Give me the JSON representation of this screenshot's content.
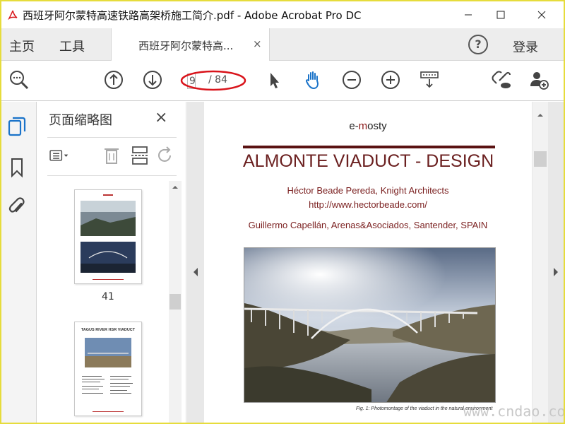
{
  "window": {
    "title": "西班牙阿尔蒙特高速铁路高架桥施工简介.pdf - Adobe Acrobat Pro DC",
    "logo_overlay": "西班牙"
  },
  "tabbar": {
    "home": "主页",
    "tools": "工具",
    "doc_tab": "西班牙阿尔蒙特高...",
    "close_tab": "×",
    "help": "?",
    "login": "登录"
  },
  "toolbar": {
    "current_page": "9",
    "total_pages": "/ 84",
    "icons": [
      "zoom-icon",
      "page-up-icon",
      "page-down-icon",
      "select-cursor-icon",
      "hand-tool-icon",
      "zoom-out-icon",
      "zoom-in-icon",
      "keyboard-scroll-icon",
      "share-link-icon",
      "add-user-icon"
    ]
  },
  "thumbnails": {
    "title": "页面缩略图",
    "close": "×",
    "pages": [
      {
        "number": "41"
      },
      {
        "number": "",
        "heading": "TAGUS RIVER HSR VIADUCT"
      }
    ]
  },
  "document": {
    "header_pre": "e-",
    "header_m": "m",
    "header_post": "osty",
    "title": "ALMONTE VIADUCT -  DESIGN",
    "author_line": "Héctor Beade Pereda, Knight Architects",
    "url": "http://www.hectorbeade.com/",
    "author_line2": "Guillermo Capellán, Arenas&Asociados, Santender, SPAIN",
    "caption": "Fig. 1: Photomontage of the viaduct in the natural environment"
  },
  "watermark": "www.cndao.com",
  "colors": {
    "title_red": "#6b2020",
    "rule": "#5a1212",
    "highlight_ellipse": "#d9141b",
    "frame": "#e6dc3c"
  }
}
